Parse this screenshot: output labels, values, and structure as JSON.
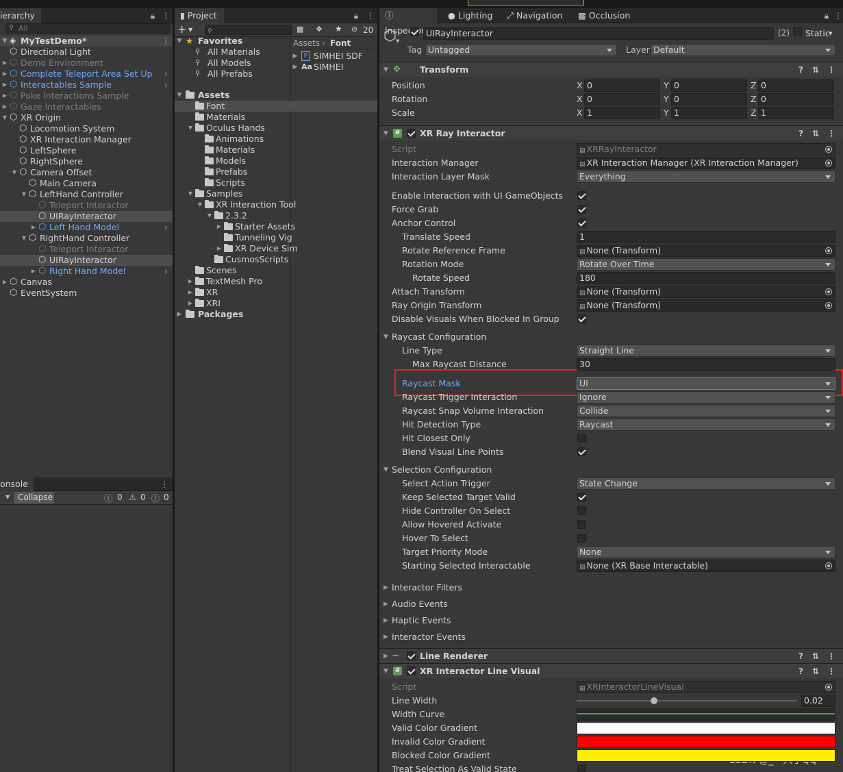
{
  "hierarchy": {
    "tab": "ierarchy",
    "search_placeholder": "All",
    "scene": "MyTestDemo*",
    "items": [
      {
        "label": "Directional Light"
      },
      {
        "label": "Demo Environment"
      },
      {
        "label": "Complete Teleport Area Set Up"
      },
      {
        "label": "Interactables Sample"
      },
      {
        "label": "Poke Interactions Sample"
      },
      {
        "label": "Gaze Interactables"
      },
      {
        "label": "XR Origin"
      },
      {
        "label": "Locomotion System"
      },
      {
        "label": "XR Interaction Manager"
      },
      {
        "label": "LeftSphere"
      },
      {
        "label": "RightSphere"
      },
      {
        "label": "Camera Offset"
      },
      {
        "label": "Main Camera"
      },
      {
        "label": "LeftHand Controller"
      },
      {
        "label": "Teleport Interactor"
      },
      {
        "label": "UIRayInteractor"
      },
      {
        "label": "Left Hand Model"
      },
      {
        "label": "RightHand Controller"
      },
      {
        "label": "Teleport Interactor"
      },
      {
        "label": "UIRayInteractor"
      },
      {
        "label": "Right Hand Model"
      },
      {
        "label": "Canvas"
      },
      {
        "label": "EventSystem"
      }
    ]
  },
  "console": {
    "tab": "onsole",
    "collapse": "Collapse",
    "counts": [
      "0",
      "0",
      "0"
    ]
  },
  "project": {
    "tab": "Project",
    "hidden_count": "20",
    "favorites": "Favorites",
    "fav_items": [
      "All Materials",
      "All Models",
      "All Prefabs"
    ],
    "assets": "Assets",
    "tree": [
      "Font",
      "Materials",
      "Oculus Hands",
      "Animations",
      "Materials",
      "Models",
      "Prefabs",
      "Scripts",
      "Samples",
      "XR Interaction Tool",
      "2.3.2",
      "Starter Assets",
      "Tunneling Vig",
      "XR Device Sim",
      "CusmosScripts",
      "Scenes",
      "TextMesh Pro",
      "XR",
      "XRI"
    ],
    "packages": "Packages",
    "breadcrumb": [
      "Assets",
      "Font"
    ],
    "files": [
      "SIMHEI SDF",
      "SIMHEI"
    ]
  },
  "inspector": {
    "tabs": [
      "Inspector",
      "Lighting",
      "Navigation",
      "Occlusion"
    ],
    "object_name": "UIRayInteractor",
    "object_count": "(2)",
    "static_label": "Static",
    "tag_label": "Tag",
    "tag_value": "Untagged",
    "layer_label": "Layer",
    "layer_value": "Default",
    "transform": {
      "title": "Transform",
      "rows": [
        {
          "label": "Position",
          "x": "0",
          "y": "0",
          "z": "0"
        },
        {
          "label": "Rotation",
          "x": "0",
          "y": "0",
          "z": "0"
        },
        {
          "label": "Scale",
          "x": "1",
          "y": "1",
          "z": "1"
        }
      ]
    },
    "ray": {
      "title": "XR Ray Interactor",
      "script_label": "Script",
      "script_value": "XRRayInteractor",
      "im_label": "Interaction Manager",
      "im_value": "XR Interaction Manager (XR Interaction Manager)",
      "ilm_label": "Interaction Layer Mask",
      "ilm_value": "Everything",
      "enable_ui": "Enable Interaction with UI GameObjects",
      "force_grab": "Force Grab",
      "anchor": "Anchor Control",
      "translate_speed": "Translate Speed",
      "translate_speed_value": "1",
      "rotate_ref": "Rotate Reference Frame",
      "rotate_ref_value": "None (Transform)",
      "rotation_mode": "Rotation Mode",
      "rotation_mode_value": "Rotate Over Time",
      "rotate_speed": "Rotate Speed",
      "rotate_speed_value": "180",
      "attach": "Attach Transform",
      "attach_value": "None (Transform)",
      "ray_origin": "Ray Origin Transform",
      "ray_origin_value": "None (Transform)",
      "disable_visuals": "Disable Visuals When Blocked In Group",
      "raycast_cfg": "Raycast Configuration",
      "line_type": "Line Type",
      "line_type_value": "Straight Line",
      "max_dist": "Max Raycast Distance",
      "max_dist_value": "30",
      "mask": "Raycast Mask",
      "mask_value": "UI",
      "trigger": "Raycast Trigger Interaction",
      "trigger_value": "Ignore",
      "snap": "Raycast Snap Volume Interaction",
      "snap_value": "Collide",
      "hit_type": "Hit Detection Type",
      "hit_type_value": "Raycast",
      "hit_closest": "Hit Closest Only",
      "blend": "Blend Visual Line Points",
      "sel_cfg": "Selection Configuration",
      "sat": "Select Action Trigger",
      "sat_value": "State Change",
      "keep": "Keep Selected Target Valid",
      "hide": "Hide Controller On Select",
      "allow": "Allow Hovered Activate",
      "hover": "Hover To Select",
      "priority": "Target Priority Mode",
      "priority_value": "None",
      "starting": "Starting Selected Interactable",
      "starting_value": "None (XR Base Interactable)",
      "filters": "Interactor Filters",
      "audio": "Audio Events",
      "haptic": "Haptic Events",
      "events": "Interactor Events"
    },
    "line_renderer": "Line Renderer",
    "line_visual": {
      "title": "XR Interactor Line Visual",
      "script_label": "Script",
      "script_value": "XRInteractorLineVisual",
      "width": "Line Width",
      "width_value": "0.02",
      "width_fraction": 0.35,
      "curve": "Width Curve",
      "valid": "Valid Color Gradient",
      "valid_color": "#ffffff",
      "invalid": "Invalid Color Gradient",
      "invalid_color": "#ff0000",
      "blocked": "Blocked Color Gradient",
      "blocked_color": "#ffee00",
      "treat": "Treat Selection As Valid State"
    },
    "highlight_color": "#e52222"
  },
  "watermark": "CSDN @_一只小QQ"
}
